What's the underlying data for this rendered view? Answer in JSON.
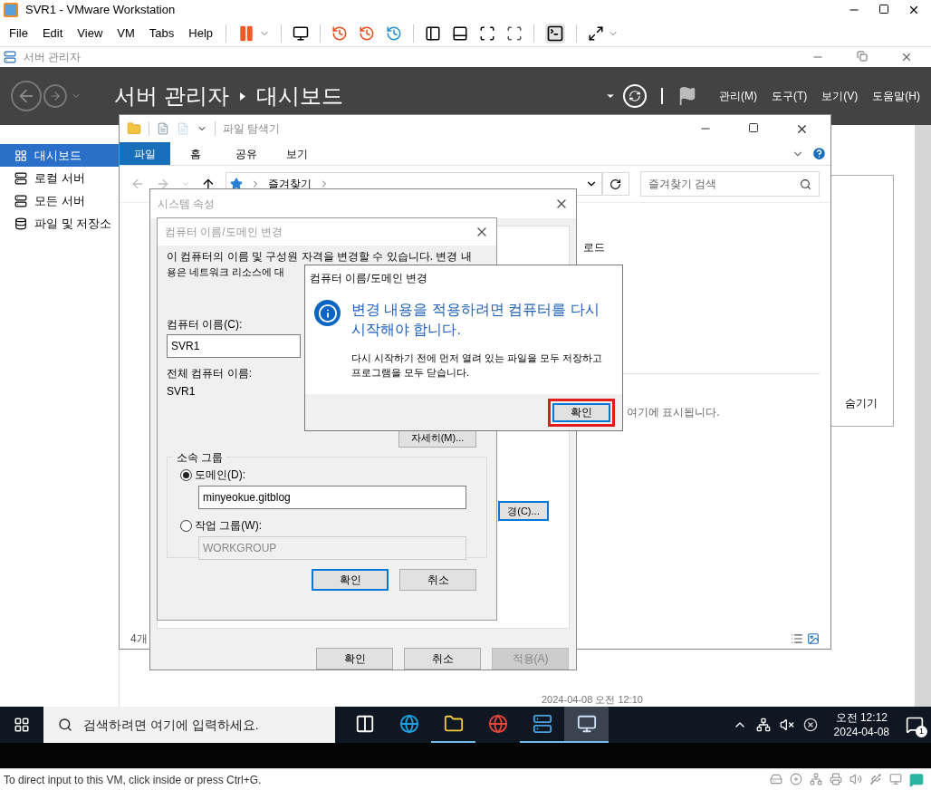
{
  "vmware": {
    "title": "SVR1 - VMware Workstation",
    "menu": [
      "File",
      "Edit",
      "View",
      "VM",
      "Tabs",
      "Help"
    ]
  },
  "server_manager": {
    "window_title": "서버 관리자",
    "breadcrumb": [
      "서버 관리자",
      "대시보드"
    ],
    "menus": [
      "관리(M)",
      "도구(T)",
      "보기(V)",
      "도움말(H)"
    ],
    "sidebar": [
      {
        "label": "대시보드",
        "selected": true
      },
      {
        "label": "로컬 서버",
        "selected": false
      },
      {
        "label": "모든 서버",
        "selected": false
      },
      {
        "label": "파일 및 저장소",
        "selected": false
      }
    ],
    "hide_label": "숨기기",
    "timestamp": "2024-04-08 오전 12:10"
  },
  "explorer": {
    "title": "파일 탐색기",
    "ribbon_tabs": [
      {
        "label": "파일",
        "selected": true
      },
      {
        "label": "홈",
        "selected": false
      },
      {
        "label": "공유",
        "selected": false
      },
      {
        "label": "보기",
        "selected": false
      }
    ],
    "address": "즐겨찾기",
    "search_placeholder": "즐겨찾기 검색",
    "partial_heading": "로드",
    "empty_note": "여기에 표시됩니다.",
    "item_count": "4개"
  },
  "system_properties": {
    "title": "시스템 속성",
    "change_button": "경(C)...",
    "buttons": [
      {
        "label": "확인",
        "disabled": false
      },
      {
        "label": "취소",
        "disabled": false
      },
      {
        "label": "적용(A)",
        "disabled": true
      }
    ]
  },
  "name_dialog": {
    "title": "컴퓨터 이름/도메인 변경",
    "intro_lines": [
      "이 컴퓨터의 이름 및 구성원 자격을 변경할 수 있습니다. 변경 내",
      "용은 네트워크 리소스에 대"
    ],
    "computer_name_label": "컴퓨터 이름(C):",
    "computer_name": "SVR1",
    "full_name_label": "전체 컴퓨터 이름:",
    "full_name": "SVR1",
    "more_button": "자세히(M)...",
    "member_of": "소속 그룹",
    "options": [
      {
        "label": "도메인(D):",
        "selected": true,
        "value": "minyeokue.gitblog",
        "disabled": false
      },
      {
        "label": "작업 그룹(W):",
        "selected": false,
        "value": "WORKGROUP",
        "disabled": true
      }
    ],
    "buttons": [
      {
        "label": "확인",
        "default": true
      },
      {
        "label": "취소",
        "default": false
      }
    ]
  },
  "message_box": {
    "title": "컴퓨터 이름/도메인 변경",
    "heading": "변경 내용을 적용하려면 컴퓨터를 다시 시작해야 합니다.",
    "body": "다시 시작하기 전에 먼저 열려 있는 파일을 모두 저장하고 프로그램을 모두 닫습니다.",
    "ok": "확인",
    "highlighted": true
  },
  "taskbar": {
    "search_placeholder": "검색하려면 여기에 입력하세요.",
    "apps": [
      {
        "running": false,
        "active": false
      },
      {
        "running": false,
        "active": false
      },
      {
        "running": true,
        "active": false
      },
      {
        "running": false,
        "active": false
      },
      {
        "running": true,
        "active": false
      },
      {
        "running": true,
        "active": true
      }
    ],
    "time": "오전 12:12",
    "date": "2024-04-08",
    "notifications": "1"
  },
  "status_bar": {
    "message": "To direct input to this VM, click inside or press Ctrl+G."
  }
}
